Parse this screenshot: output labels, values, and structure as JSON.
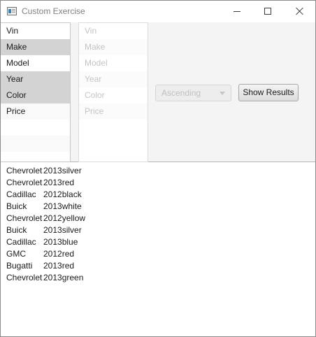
{
  "window": {
    "title": "Custom Exercise",
    "icon": "app-window-icon",
    "controls": [
      "minimize-icon",
      "maximize-icon",
      "close-icon"
    ]
  },
  "field_list": {
    "items": [
      {
        "label": "Vin",
        "selected": false
      },
      {
        "label": "Make",
        "selected": true
      },
      {
        "label": "Model",
        "selected": false
      },
      {
        "label": "Year",
        "selected": true
      },
      {
        "label": "Color",
        "selected": true
      },
      {
        "label": "Price",
        "selected": false
      }
    ]
  },
  "sort_field_list": {
    "disabled": true,
    "items": [
      "Vin",
      "Make",
      "Model",
      "Year",
      "Color",
      "Price"
    ]
  },
  "sort_order": {
    "value": "Ascending",
    "disabled": true
  },
  "show_results_button": {
    "label": "Show Results"
  },
  "results": [
    {
      "make": "Chevrolet",
      "rest": "2013silver"
    },
    {
      "make": "Chevrolet",
      "rest": "2013red"
    },
    {
      "make": "Cadillac",
      "rest": "2012black"
    },
    {
      "make": "Buick",
      "rest": "2013white"
    },
    {
      "make": "Chevrolet",
      "rest": "2012yellow"
    },
    {
      "make": "Buick",
      "rest": "2013silver"
    },
    {
      "make": "Cadillac",
      "rest": "2013blue"
    },
    {
      "make": "GMC",
      "rest": "2012red"
    },
    {
      "make": "Bugatti",
      "rest": "2013red"
    },
    {
      "make": "Chevrolet",
      "rest": "2013green"
    }
  ]
}
